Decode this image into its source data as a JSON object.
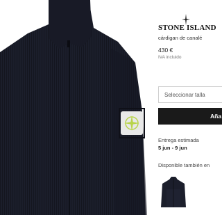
{
  "brand": {
    "name": "STONE ISLAND",
    "logo_icon": "compass-rose-icon"
  },
  "product": {
    "name": "cárdigan de canalé",
    "price": "430 €",
    "tax_note": "IVA incluido",
    "image_icon": "knit-cardigan-photo",
    "badge_icon": "stone-island-compass-badge"
  },
  "size_select": {
    "placeholder": "Seleccionar talla"
  },
  "add_button": {
    "label": "Aña"
  },
  "delivery": {
    "label": "Entrega estimada",
    "dates": "5 jun - 9 jun"
  },
  "also_available": {
    "label": "Disponible también en",
    "thumb_icon": "navy-cardigan-thumbnail"
  },
  "colors": {
    "garment": "#1b1e2b",
    "button": "#1a1a1a",
    "badge_green": "#b8d44a"
  }
}
